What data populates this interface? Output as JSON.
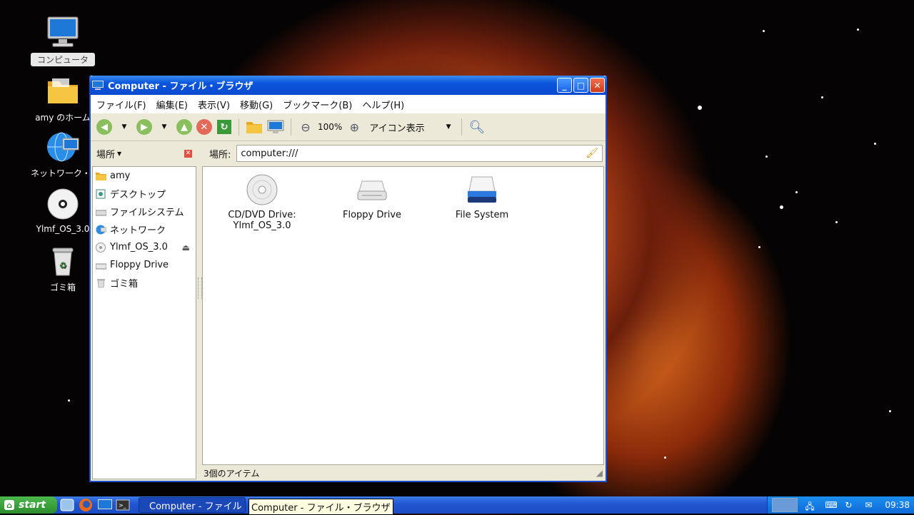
{
  "desktop": {
    "icons": [
      {
        "label": "コンピュータ",
        "icon": "computer-icon"
      },
      {
        "label": "amy のホーム",
        "icon": "home-folder-icon"
      },
      {
        "label": "ネットワーク・サーバ",
        "icon": "network-icon"
      },
      {
        "label": "Ylmf_OS_3.0",
        "icon": "cd-icon"
      },
      {
        "label": "ゴミ箱",
        "icon": "trash-icon"
      }
    ]
  },
  "window": {
    "title": "Computer - ファイル・ブラウザ",
    "menu": [
      "ファイル(F)",
      "編集(E)",
      "表示(V)",
      "移動(G)",
      "ブックマーク(B)",
      "ヘルプ(H)"
    ],
    "toolbar": {
      "zoom": "100%",
      "view_mode": "アイコン表示"
    },
    "sidebar": {
      "header": "場所",
      "items": [
        {
          "label": "amy",
          "icon": "home-folder-icon"
        },
        {
          "label": "デスクトップ",
          "icon": "desktop-icon"
        },
        {
          "label": "ファイルシステム",
          "icon": "drive-icon"
        },
        {
          "label": "ネットワーク",
          "icon": "network-icon"
        },
        {
          "label": "Ylmf_OS_3.0",
          "icon": "cd-icon"
        },
        {
          "label": "Floppy Drive",
          "icon": "floppy-icon"
        },
        {
          "label": "ゴミ箱",
          "icon": "trash-icon"
        }
      ]
    },
    "location": {
      "label": "場所:",
      "value": "computer:///"
    },
    "files": [
      {
        "line1": "CD/DVD Drive:",
        "line2": "Ylmf_OS_3.0",
        "icon": "cd-drive-icon"
      },
      {
        "line1": "Floppy Drive",
        "line2": "",
        "icon": "floppy-drive-icon"
      },
      {
        "line1": "File System",
        "line2": "",
        "icon": "hard-drive-icon"
      }
    ],
    "status": "3個のアイテム"
  },
  "taskbar": {
    "start_label": "start",
    "task_label": "Computer - ファイル・ブラウザ",
    "tooltip": "Computer - ファイル・ブラウザ",
    "clock": "09:38"
  },
  "colors": {
    "titlebar": "#0a55dc",
    "taskbar": "#2257d2",
    "start": "#2d8c2d"
  }
}
